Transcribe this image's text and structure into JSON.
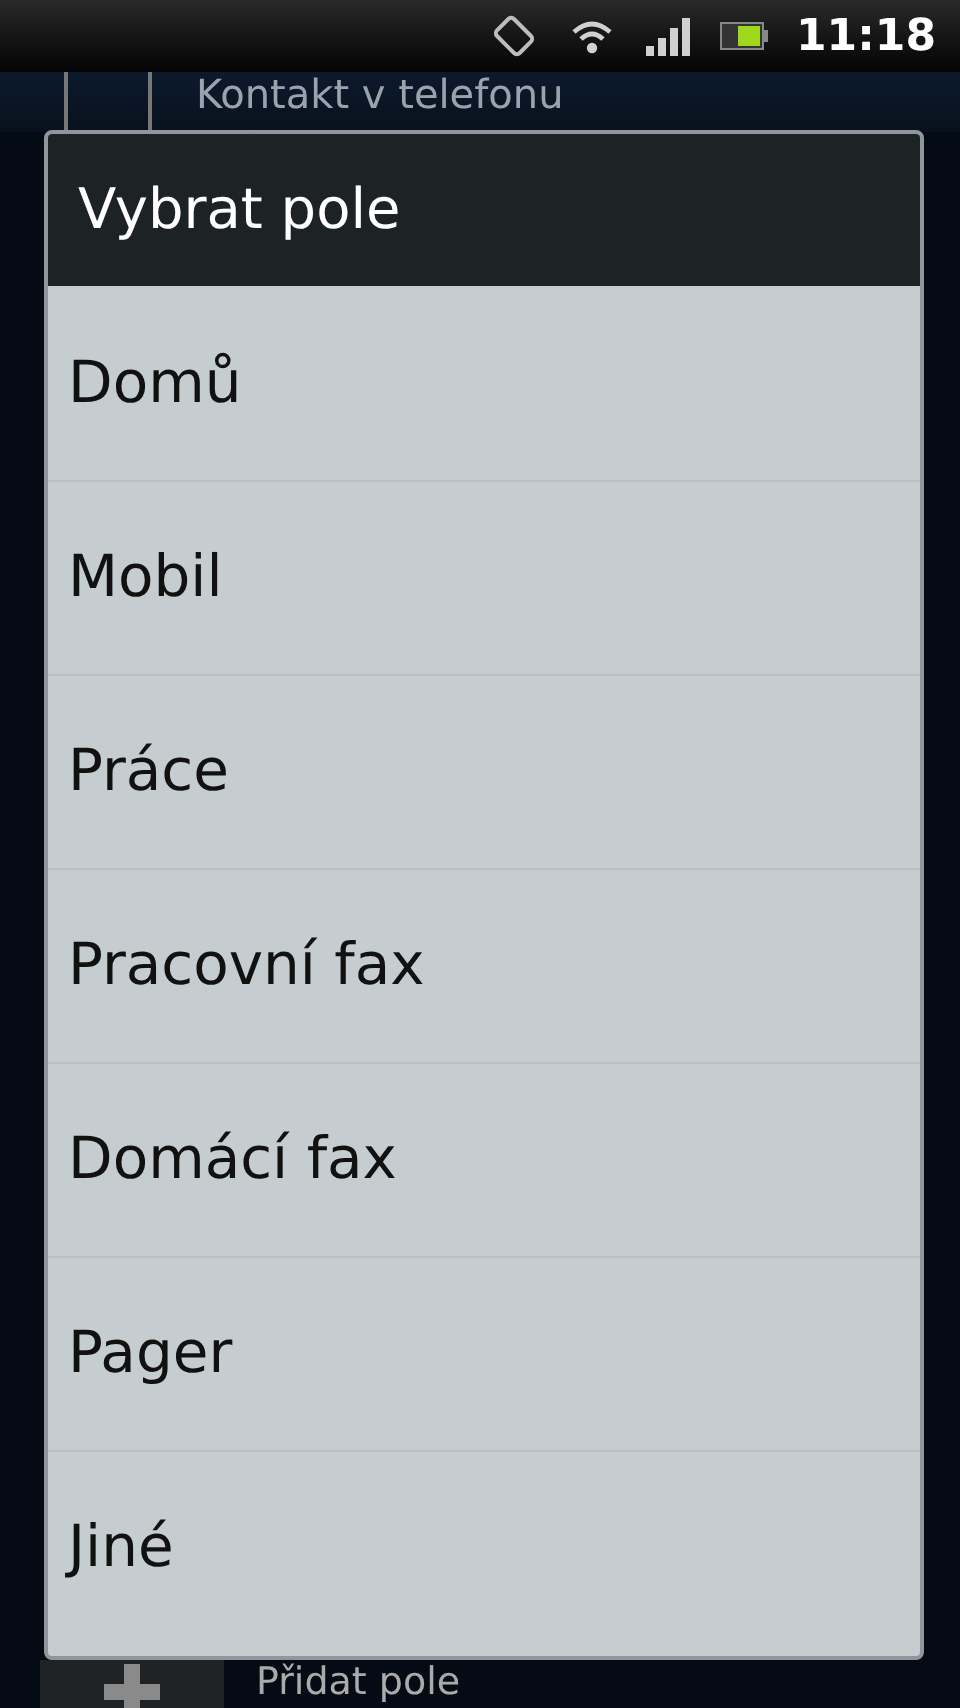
{
  "status_bar": {
    "time": "11:18"
  },
  "background": {
    "contact_source": "Kontakt v telefonu",
    "add_field": "Přidat pole"
  },
  "dialog": {
    "title": "Vybrat pole",
    "options": [
      "Domů",
      "Mobil",
      "Práce",
      "Pracovní fax",
      "Domácí fax",
      "Pager",
      "Jiné"
    ]
  }
}
